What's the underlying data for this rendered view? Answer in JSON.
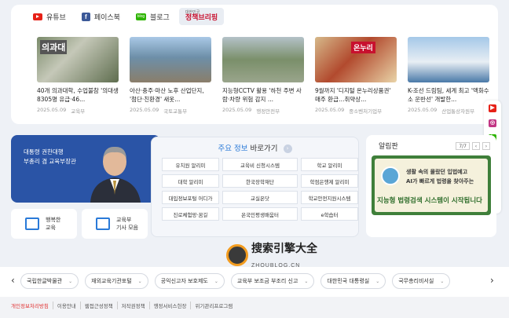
{
  "social_tabs": [
    {
      "label": "유튜브",
      "icon": "youtube-icon"
    },
    {
      "label": "페이스북",
      "icon": "facebook-icon"
    },
    {
      "label": "블로그",
      "icon": "blog-icon"
    }
  ],
  "policy_tab": {
    "small": "대한민국",
    "label": "정책브리핑"
  },
  "news": [
    {
      "title": "40개 의과대학, 수업불참 '의대생 8305명 유급·46...",
      "date": "2025.05.09",
      "source": "교육부",
      "thumb_label": "의과대"
    },
    {
      "title": "아산·충주·마산 노후 산업단지, '첨단·친환경' 새옷...",
      "date": "2025.05.09",
      "source": "국토교통부",
      "thumb_label": ""
    },
    {
      "title": "지능형CCTV 활용 '하천 주변 사람·차량 위험 감지 ...",
      "date": "2025.05.09",
      "source": "행정안전부",
      "thumb_label": ""
    },
    {
      "title": "9월까지 '디지털 온누리상품권' 매주 환급…취약상...",
      "date": "2025.05.09",
      "source": "중소벤처기업부",
      "thumb_label": "온누리"
    },
    {
      "title": "K-조선 드림팀, 세계 최고 '액화수소 운반선' 개발한...",
      "date": "2025.05.09",
      "source": "산업통상자원부",
      "thumb_label": ""
    }
  ],
  "policy_card": {
    "line1": "대통령 권한대행",
    "line2": "부총리 겸 교육부장관"
  },
  "quick_links": [
    {
      "line1": "행복한",
      "line2": "교육",
      "icon": "school-icon"
    },
    {
      "line1": "교육부",
      "line2": "기사 모음",
      "icon": "news-icon"
    }
  ],
  "quick_panel": {
    "title_highlight": "주요 정보",
    "title_rest": " 바로가기",
    "arrow": "›",
    "items": [
      "유치원 알리미",
      "교육비 신청시스템",
      "학교 알리미",
      "대학 알리미",
      "한국장학재단",
      "학점은행제 알리미",
      "대입정보포털 어디가",
      "교실온닷",
      "학교안전지원시스템",
      "진로체험망·꿈길",
      "온국민평생배움터",
      "e학습터"
    ]
  },
  "notice": {
    "title": "알림판",
    "page": "7/7",
    "prev": "‹",
    "next": "›",
    "banner_line1": "생활 속의 몰랐던 입법예고",
    "banner_line2": "AI가 빠르게 법령을 찾아주는",
    "banner_big": "지능형 법령검색 시스템이 시작됩니다"
  },
  "side_sns": [
    {
      "icon": "youtube-icon",
      "color": "#e62117",
      "glyph": "▶"
    },
    {
      "icon": "instagram-icon",
      "color": "#c13584",
      "glyph": "◎"
    },
    {
      "icon": "blog-icon",
      "color": "#2db400",
      "glyph": "b"
    },
    {
      "icon": "facebook-icon",
      "color": "#3b5998",
      "glyph": "f"
    },
    {
      "icon": "kakao-icon",
      "color": "#f7c600",
      "glyph": "●"
    },
    {
      "icon": "band-icon",
      "color": "#2db400",
      "glyph": "b"
    }
  ],
  "related_links": {
    "prev": "‹",
    "next": "›",
    "items": [
      "국립한글박물관",
      "재외교육기관포털",
      "공익신고자 보호제도",
      "교육부 보조금 부조리 신고",
      "대한민국 대통령실",
      "국무총리비서실"
    ]
  },
  "footer": [
    "개인정보처리방침",
    "이용안내",
    "웹접근성정책",
    "저작권정책",
    "행정서비스헌장",
    "위기관리프로그램"
  ],
  "watermark": {
    "text": "搜索引擎大全",
    "url": "ZHOUBLOG.CN"
  }
}
